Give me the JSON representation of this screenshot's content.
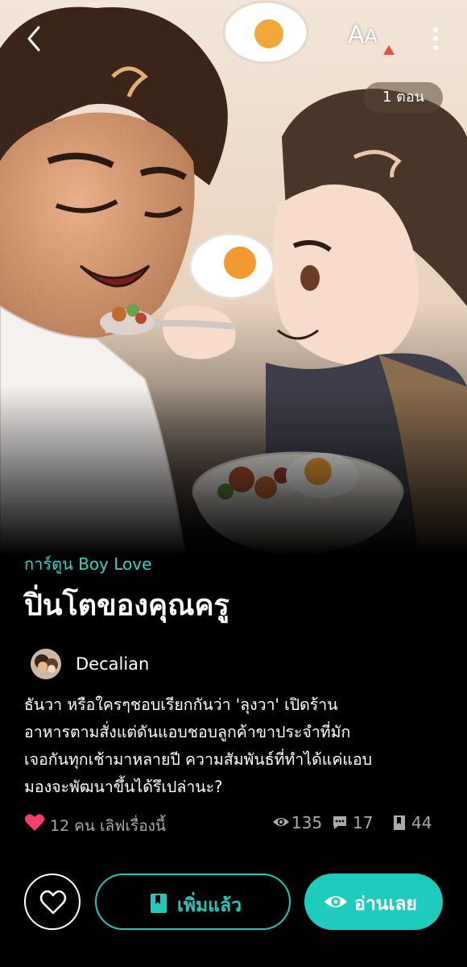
{
  "header": {
    "font_size_label_big": "A",
    "font_size_label_small": "A",
    "episode_count": "1 ตอน"
  },
  "cover": {
    "icons": [
      "back-arrow-icon",
      "font-size-icon",
      "more-vertical-icon"
    ]
  },
  "story": {
    "genre": "การ์ตูน Boy Love",
    "title": "ปิ่นโตของคุณครู",
    "author": "Decalian",
    "description_lines": [
      "ธันวา หรือใครๆชอบเรียกกันว่า 'ลุงวา' เปิดร้าน",
      "อาหารตามสั่งแต่ดันแอบชอบลูกค้าขาประจำที่มัก",
      "เจอกันทุกเช้ามาหลายปี ความสัมพันธ์ที่ทำได้แค่แอบ",
      "มองจะพัฒนาขึ้นได้รึเปล่านะ?"
    ]
  },
  "stats": {
    "likes_text": "12 คน เลิฟเรื่องนี้",
    "views": "135",
    "comments": "17",
    "chapters": "44"
  },
  "actions": {
    "library_label": "เพิ่มแล้ว",
    "read_label": "อ่านเลย"
  },
  "colors": {
    "accent": "#1fcbbd",
    "genre": "#2ad5c7",
    "heart": "#ff3d6e",
    "background": "#000000"
  }
}
